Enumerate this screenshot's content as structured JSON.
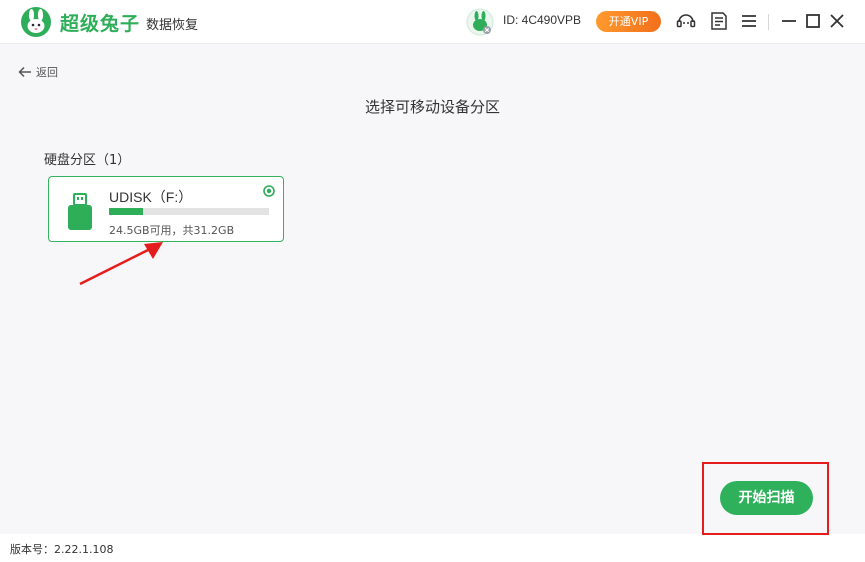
{
  "header": {
    "logo_text": "超级兔子",
    "logo_subtitle": "数据恢复",
    "user_id": "ID: 4C490VPB",
    "vip_label": "开通VIP",
    "icons": [
      "rabbit-logo-icon",
      "user-avatar-icon",
      "customer-service-icon",
      "feedback-icon",
      "menu-icon",
      "minimize-icon",
      "maximize-icon",
      "close-icon"
    ]
  },
  "nav": {
    "back_label": "返回"
  },
  "main": {
    "title": "选择可移动设备分区",
    "section_label": "硬盘分区（1）",
    "partitions": [
      {
        "name": "UDISK（F:）",
        "size_text": "24.5GB可用，共31.2GB",
        "used_fraction": 0.215,
        "selected": true
      }
    ]
  },
  "actions": {
    "scan_label": "开始扫描"
  },
  "footer": {
    "version": "版本号：2.22.1.108"
  },
  "colors": {
    "brand_green": "#2fae5a",
    "vip_orange": "#f5801f",
    "annotation_red": "#e51c1c"
  }
}
